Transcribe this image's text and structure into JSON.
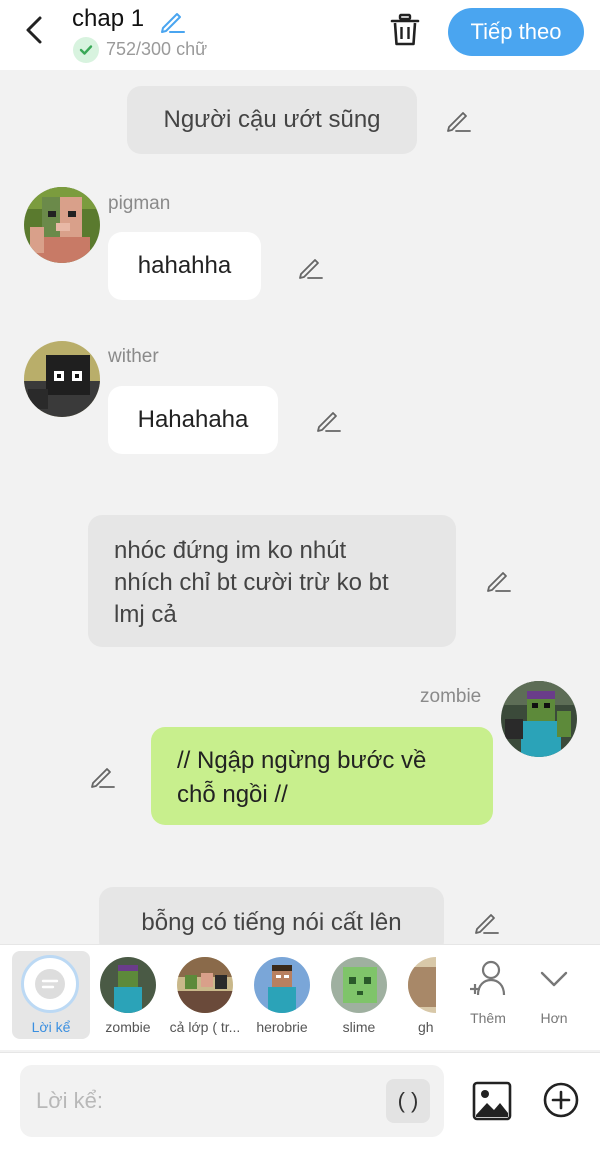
{
  "header": {
    "title": "chap 1",
    "word_count": "752/300 chữ",
    "next_label": "Tiếp theo"
  },
  "messages": {
    "m1": "Người cậu ướt sũng",
    "m2_name": "pigman",
    "m2_text": "hahahha",
    "m3_name": "wither",
    "m3_text": "Hahahaha",
    "m4_line1": "nhóc đứng im ko nhút",
    "m4_line2": "nhích chỉ bt cười trừ ko bt",
    "m4_line3": "lmj cả",
    "m5_name": "zombie",
    "m5_line1": "// Ngập ngừng bước về",
    "m5_line2": "chỗ ngồi //",
    "m6": "bỗng có tiếng nói cất lên"
  },
  "charbar": {
    "narrator_label": "Lời kể",
    "characters": [
      "zombie",
      "cả lớp ( tr...",
      "herobrie",
      "slime",
      "gh"
    ],
    "add_label": "Thêm",
    "more_label": "Hơn"
  },
  "input": {
    "placeholder": "Lời kể:",
    "paren_label": "( )"
  },
  "colors": {
    "accent": "#4aa5f0",
    "own_bubble": "#c8ef8d",
    "narration_bubble": "#e6e6e6",
    "background": "#f2f2f2"
  }
}
